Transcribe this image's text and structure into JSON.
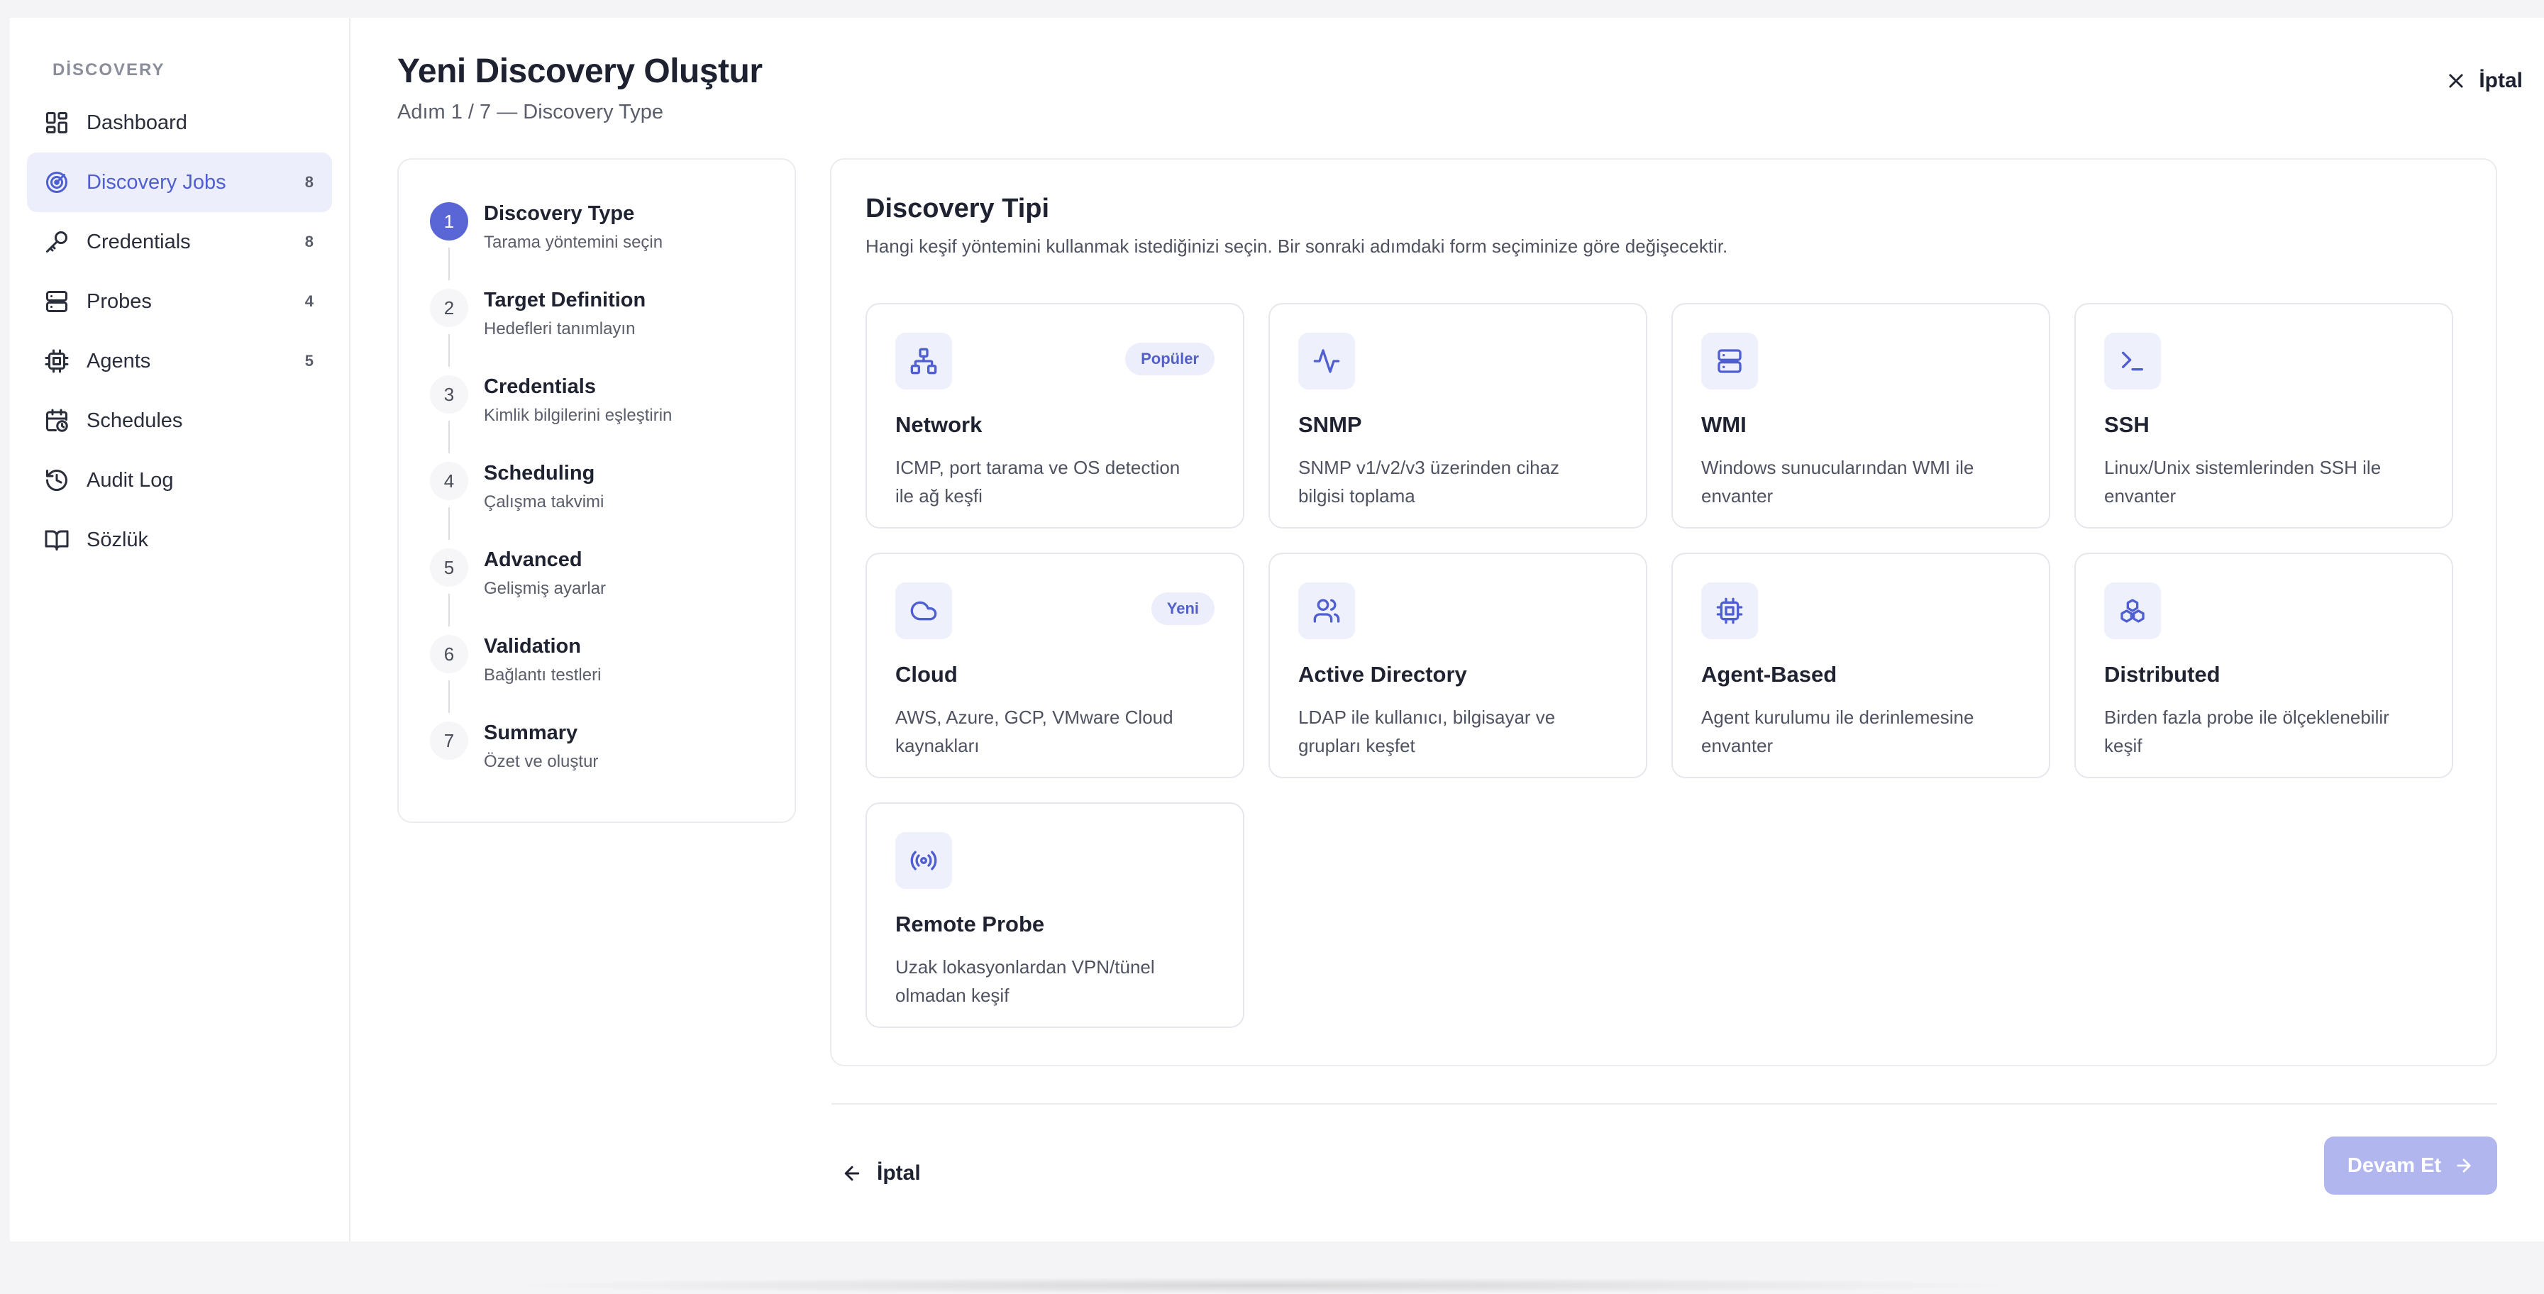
{
  "sidebar": {
    "section_label": "DİSCOVERY",
    "items": [
      {
        "label": "Dashboard",
        "count": "",
        "icon": "dashboard-icon"
      },
      {
        "label": "Discovery Jobs",
        "count": "8",
        "icon": "radar-icon"
      },
      {
        "label": "Credentials",
        "count": "8",
        "icon": "key-icon"
      },
      {
        "label": "Probes",
        "count": "4",
        "icon": "server-icon"
      },
      {
        "label": "Agents",
        "count": "5",
        "icon": "cpu-icon"
      },
      {
        "label": "Schedules",
        "count": "",
        "icon": "calendar-clock-icon"
      },
      {
        "label": "Audit Log",
        "count": "",
        "icon": "history-icon"
      },
      {
        "label": "Sözlük",
        "count": "",
        "icon": "book-icon"
      }
    ]
  },
  "header": {
    "title": "Yeni Discovery Oluştur",
    "subtitle": "Adım 1 / 7 — Discovery Type",
    "cancel_label": "İptal"
  },
  "steps": [
    {
      "num": "1",
      "title": "Discovery Type",
      "desc": "Tarama yöntemini seçin"
    },
    {
      "num": "2",
      "title": "Target Definition",
      "desc": "Hedefleri tanımlayın"
    },
    {
      "num": "3",
      "title": "Credentials",
      "desc": "Kimlik bilgilerini eşleştirin"
    },
    {
      "num": "4",
      "title": "Scheduling",
      "desc": "Çalışma takvimi"
    },
    {
      "num": "5",
      "title": "Advanced",
      "desc": "Gelişmiş ayarlar"
    },
    {
      "num": "6",
      "title": "Validation",
      "desc": "Bağlantı testleri"
    },
    {
      "num": "7",
      "title": "Summary",
      "desc": "Özet ve oluştur"
    }
  ],
  "panel": {
    "title": "Discovery Tipi",
    "description": "Hangi keşif yöntemini kullanmak istediğinizi seçin. Bir sonraki adımdaki form seçiminize göre değişecektir.",
    "cards": [
      {
        "title": "Network",
        "desc": "ICMP, port tarama ve OS detection ile ağ keşfi",
        "badge": "Popüler",
        "icon": "network-icon"
      },
      {
        "title": "SNMP",
        "desc": "SNMP v1/v2/v3 üzerinden cihaz bilgisi toplama",
        "badge": "",
        "icon": "activity-icon"
      },
      {
        "title": "WMI",
        "desc": "Windows sunucularından WMI ile envanter",
        "badge": "",
        "icon": "server-icon"
      },
      {
        "title": "SSH",
        "desc": "Linux/Unix sistemlerinden SSH ile envanter",
        "badge": "",
        "icon": "terminal-icon"
      },
      {
        "title": "Cloud",
        "desc": "AWS, Azure, GCP, VMware Cloud kaynakları",
        "badge": "Yeni",
        "icon": "cloud-icon"
      },
      {
        "title": "Active Directory",
        "desc": "LDAP ile kullanıcı, bilgisayar ve grupları keşfet",
        "badge": "",
        "icon": "users-icon"
      },
      {
        "title": "Agent-Based",
        "desc": "Agent kurulumu ile derinlemesine envanter",
        "badge": "",
        "icon": "cpu-icon"
      },
      {
        "title": "Distributed",
        "desc": "Birden fazla probe ile ölçeklenebilir keşif",
        "badge": "",
        "icon": "boxes-icon"
      },
      {
        "title": "Remote Probe",
        "desc": "Uzak lokasyonlardan VPN/tünel olmadan keşif",
        "badge": "",
        "icon": "broadcast-icon"
      }
    ]
  },
  "footer": {
    "back_label": "İptal",
    "next_label": "Devam Et"
  },
  "colors": {
    "accent": "#5a66d6",
    "accent_light": "#eceefb",
    "next_disabled": "#b1b7ee"
  }
}
